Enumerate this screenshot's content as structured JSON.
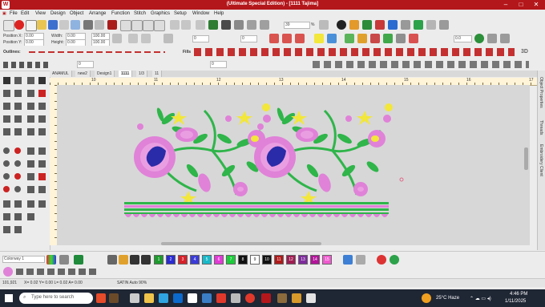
{
  "window": {
    "title": "(Ultimate Special Edition) - [1111    Tajima]",
    "logo": "W"
  },
  "menu": [
    "File",
    "Edit",
    "View",
    "Design",
    "Object",
    "Arrange",
    "Function",
    "Stitch",
    "Graphics",
    "Setup",
    "Window",
    "Help"
  ],
  "toolbar1": {
    "zoom_value": "39",
    "zoom_unit": "%",
    "speed_value": "0.0",
    "units_value": "0.0"
  },
  "toolbar2": {
    "position_x_label": "Position X:",
    "position_x_value": "0.00",
    "position_y_label": "Position Y:",
    "position_y_value": "0.00",
    "width_label": "Width:",
    "width_value": "0.00",
    "height_label": "Height:",
    "height_value": "0.00",
    "width_pct": "100.00",
    "height_pct": "100.00",
    "angle_value": "0",
    "a1": "0",
    "a2": "0",
    "a3": "0"
  },
  "toolbar3": {
    "outlines_label": "Outlines:",
    "fills_label": "Fills",
    "view3d_label": "3D"
  },
  "tabs": [
    "ANAMUL",
    "new2",
    "Design1",
    "1111",
    "1/3",
    "11"
  ],
  "ruler_ticks": [
    "10",
    "11",
    "12",
    "13",
    "14",
    "15",
    "16",
    "17",
    "18",
    "19"
  ],
  "right_panel": [
    "Object Properties",
    "Threads",
    "Embroidery Client"
  ],
  "palette": {
    "colorway_label": "Colorway 1",
    "swatches": [
      {
        "n": "1",
        "color": "#1e9b2d"
      },
      {
        "n": "2",
        "color": "#2a2bd1"
      },
      {
        "n": "3",
        "color": "#d6212a"
      },
      {
        "n": "4",
        "color": "#3b3bd8"
      },
      {
        "n": "5",
        "color": "#18b9c9"
      },
      {
        "n": "6",
        "color": "#e23ad6"
      },
      {
        "n": "7",
        "color": "#1ccc3a"
      },
      {
        "n": "8",
        "color": "#111111"
      },
      {
        "n": "9",
        "color": "#ffffff"
      },
      {
        "n": "10",
        "color": "#111111"
      },
      {
        "n": "11",
        "color": "#b01919"
      },
      {
        "n": "12",
        "color": "#a01c52"
      },
      {
        "n": "13",
        "color": "#7f2b9c"
      },
      {
        "n": "14",
        "color": "#b2149a"
      },
      {
        "n": "15",
        "color": "#f05ad0"
      }
    ]
  },
  "status": {
    "coords": "101,921",
    "x_info": "X=  0.02  Y=  0.00  L=  0.02  A=   0.00",
    "mode": "SATIN Auto 90%"
  },
  "taskbar": {
    "search_placeholder": "Type here to search",
    "weather": "25°C  Haze",
    "time": "4:46 PM",
    "date": "1/11/2025"
  },
  "colors": {
    "titlebar": "#b4171b",
    "canvas": "#d7d7d7",
    "pink": "#e082d8",
    "green": "#2fb54a",
    "yellow": "#f2e73a",
    "navy": "#2a2ba8"
  }
}
